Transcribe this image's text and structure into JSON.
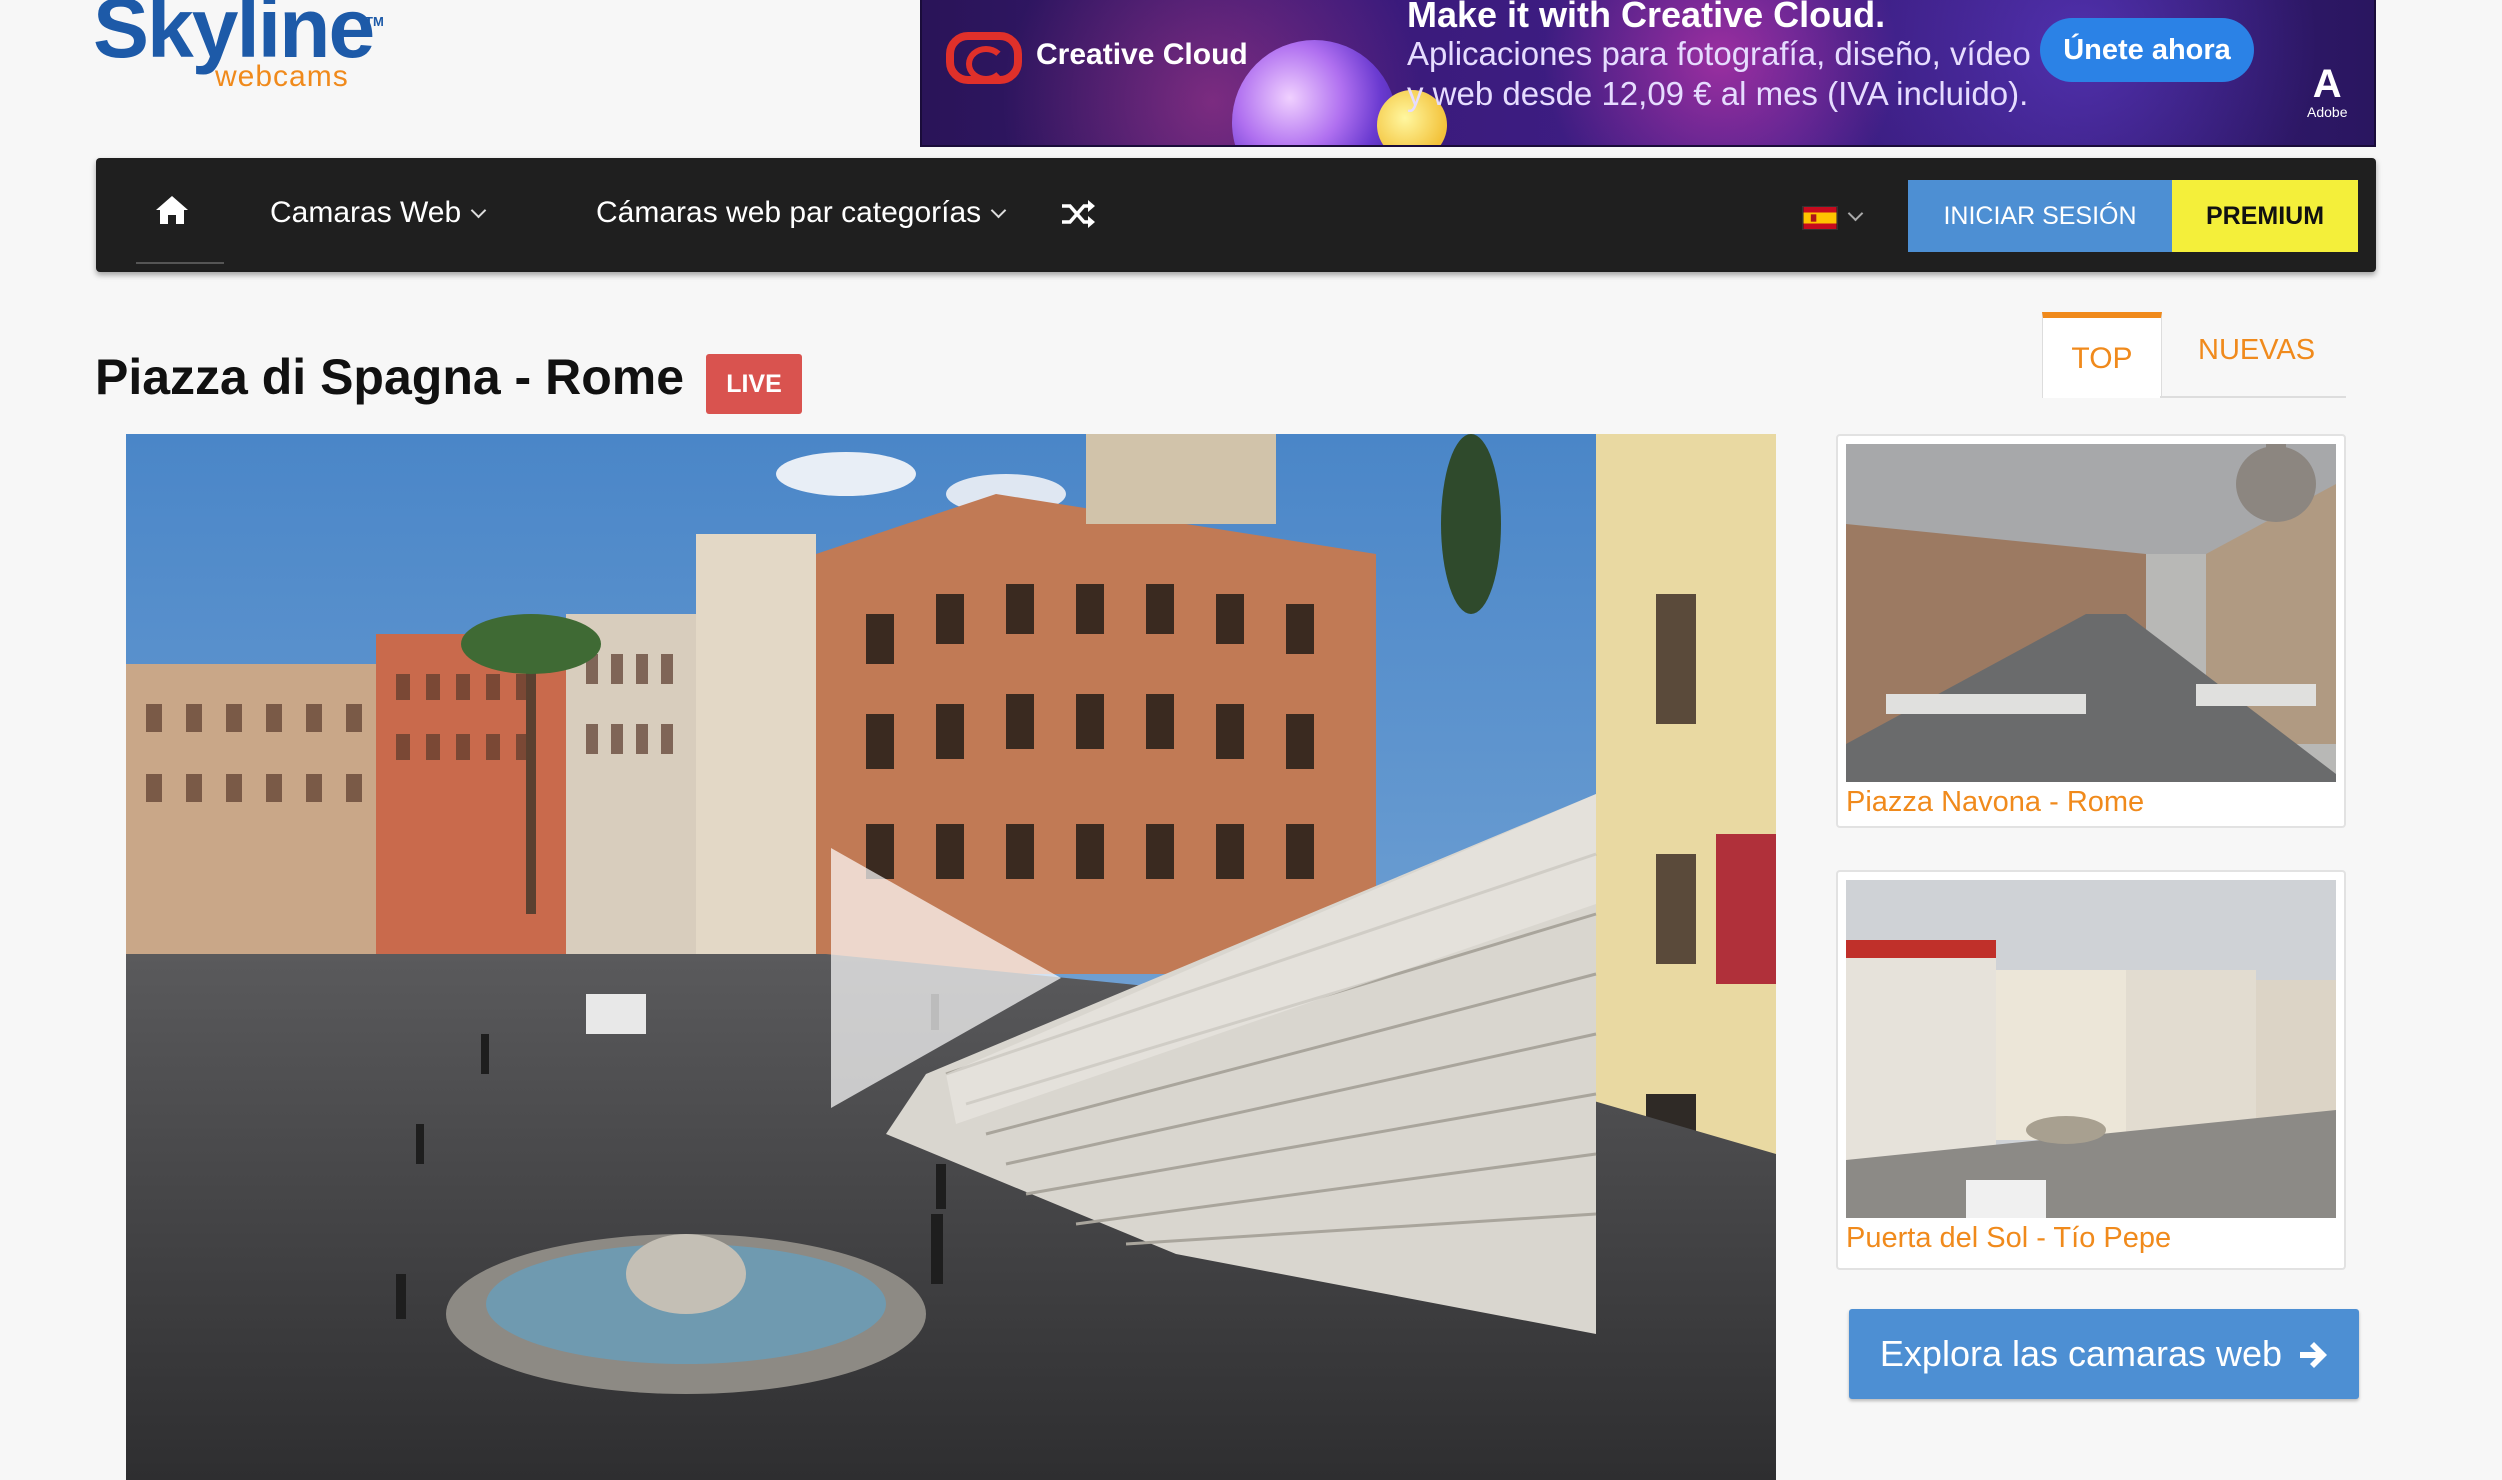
{
  "logo": {
    "main": "Skyline",
    "sub": "webcams",
    "tm": "TM"
  },
  "ad": {
    "brand": "Creative Cloud",
    "headline": "Make it with Creative Cloud.",
    "body": "Aplicaciones para fotografía, diseño, vídeo y web desde 12,09 € al mes (IVA incluido).",
    "cta": "Únete ahora",
    "adobe_mark": "A",
    "adobe_text": "Adobe"
  },
  "nav": {
    "home_icon": "home-icon",
    "items": [
      {
        "label": "Camaras Web"
      },
      {
        "label": "Cámaras web par categorías"
      }
    ],
    "shuffle_icon": "shuffle-icon",
    "language_flag": "spain-flag-icon",
    "login_label": "INICIAR SESIÓN",
    "premium_label": "PREMIUM"
  },
  "page": {
    "title": "Piazza di Spagna - Rome",
    "live_badge": "LIVE"
  },
  "sidebar": {
    "tabs": [
      {
        "label": "TOP",
        "active": true
      },
      {
        "label": "NUEVAS",
        "active": false
      }
    ],
    "cams": [
      {
        "label": "Piazza Navona - Rome"
      },
      {
        "label": "Puerta del Sol - Tío Pepe"
      }
    ],
    "explore_label": "Explora las camaras web"
  },
  "colors": {
    "brand_blue": "#1d5aa8",
    "brand_orange": "#f08a1c",
    "nav_bg": "#1f1f1f",
    "login_blue": "#4d8fd3",
    "premium_yellow": "#f4ef3a",
    "live_red": "#d9534f"
  }
}
